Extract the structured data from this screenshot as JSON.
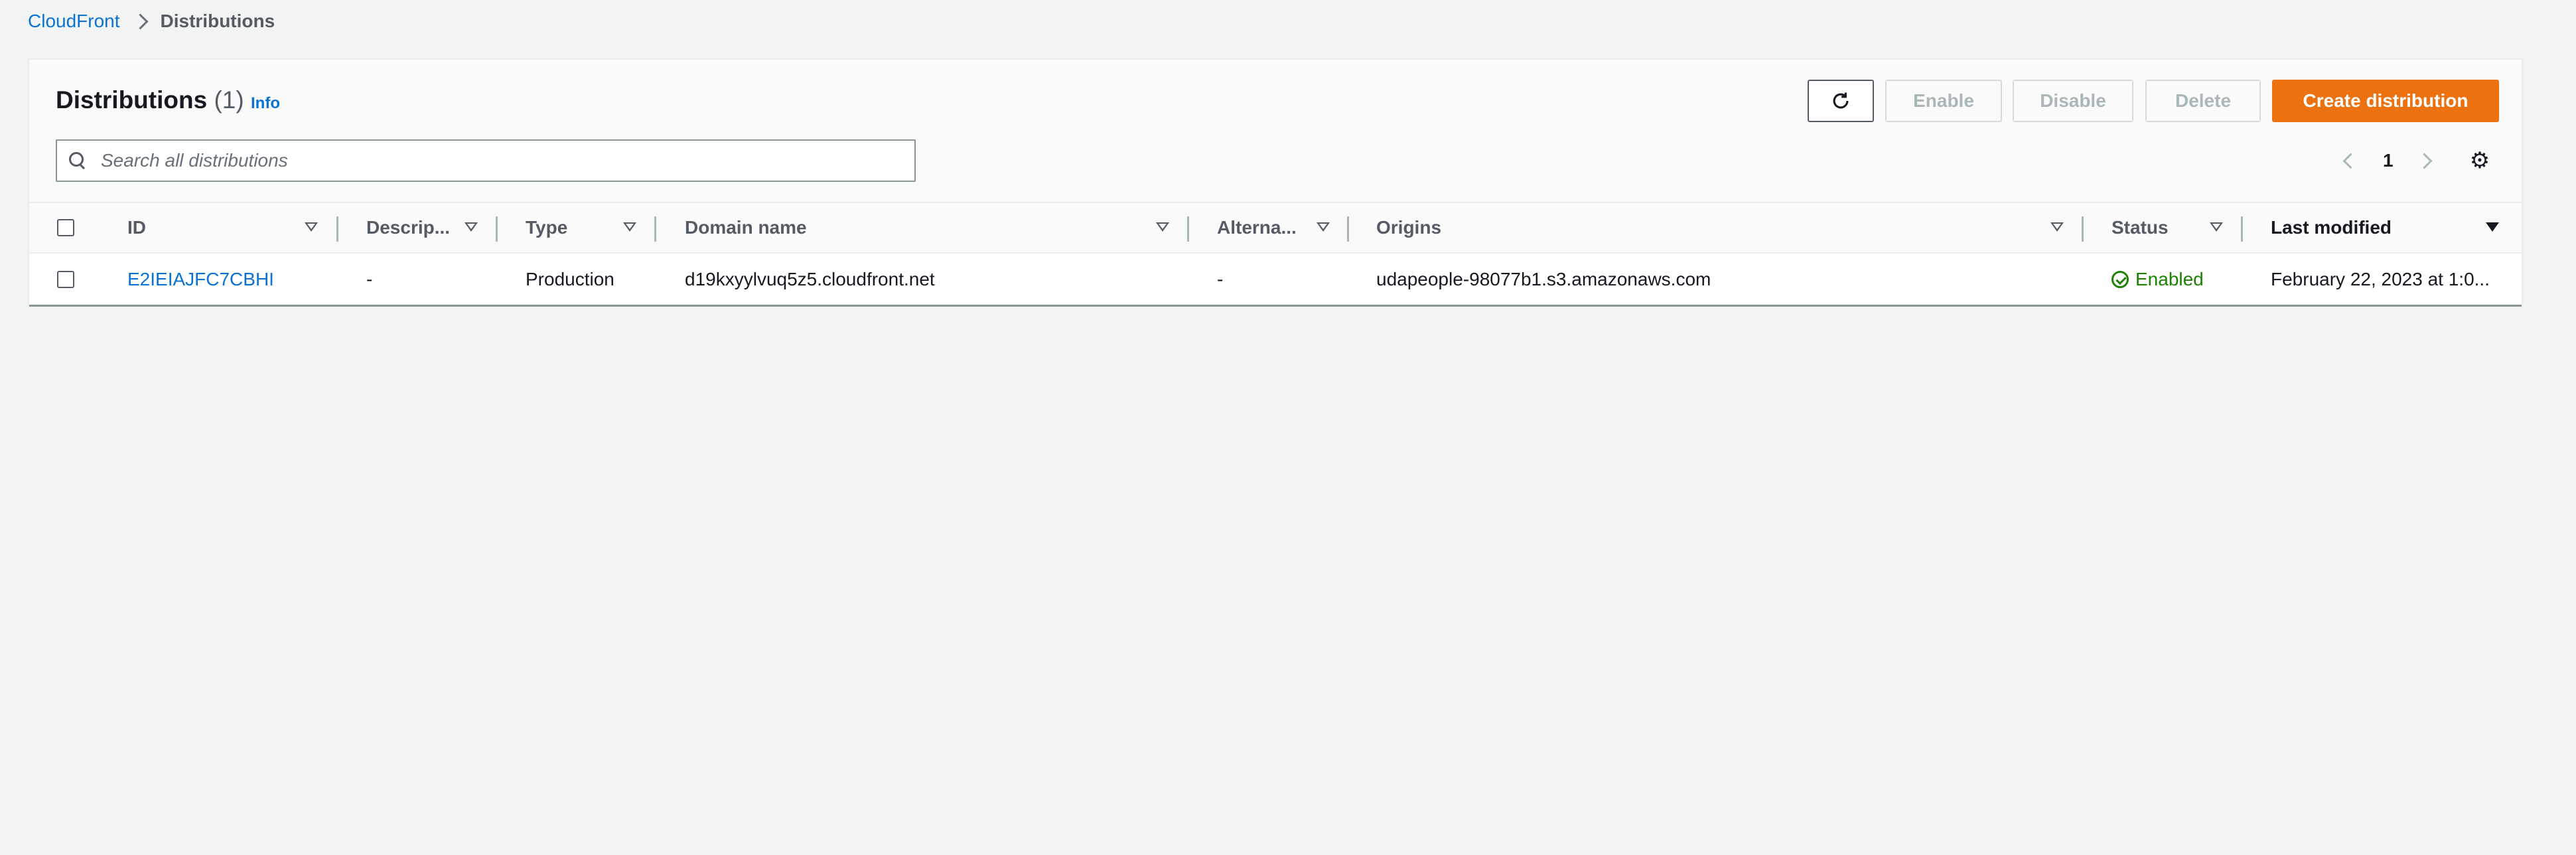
{
  "breadcrumb": {
    "root": "CloudFront",
    "current": "Distributions"
  },
  "header": {
    "title": "Distributions",
    "count": "(1)",
    "info": "Info"
  },
  "toolbar": {
    "enable": "Enable",
    "disable": "Disable",
    "delete": "Delete",
    "create": "Create distribution"
  },
  "search": {
    "placeholder": "Search all distributions"
  },
  "pagination": {
    "page": "1"
  },
  "table": {
    "columns": [
      "ID",
      "Descrip...",
      "Type",
      "Domain name",
      "Alterna...",
      "Origins",
      "Status",
      "Last modified"
    ],
    "rows": [
      {
        "id": "E2IEIAJFC7CBHI",
        "description": "-",
        "type": "Production",
        "domain": "d19kxyylvuq5z5.cloudfront.net",
        "alternate": "-",
        "origins": "udapeople-98077b1.s3.amazonaws.com",
        "status": "Enabled",
        "modified": "February 22, 2023 at 1:0..."
      }
    ]
  },
  "colors": {
    "accent": "#ec7211",
    "link": "#0972d3",
    "success": "#1d8102"
  },
  "icons": [
    "chevron-right-icon",
    "refresh-icon",
    "search-icon",
    "chevron-left-icon",
    "settings-gear-icon",
    "filter-icon",
    "status-ok-icon"
  ]
}
